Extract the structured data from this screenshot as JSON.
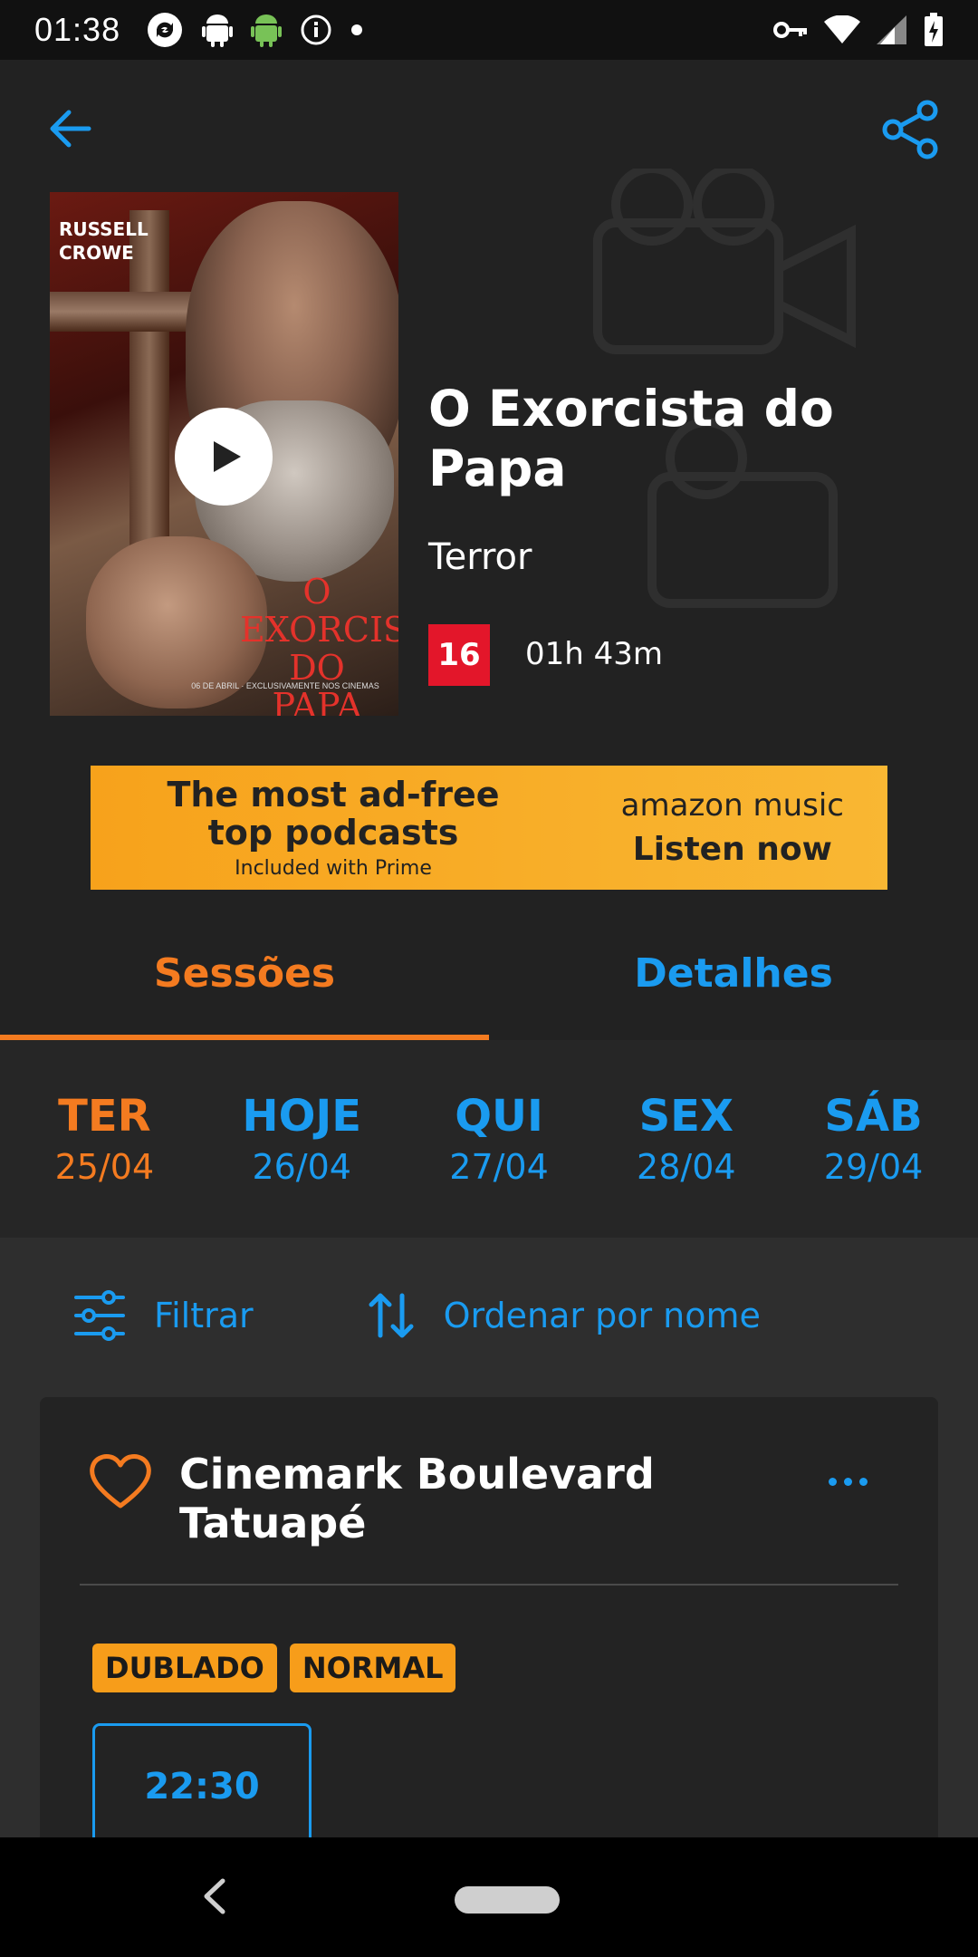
{
  "status_bar": {
    "time": "01:38",
    "left_icons": [
      "sync-icon",
      "android-icon",
      "android-green-icon",
      "info-icon",
      "dot-icon"
    ],
    "right_icons": [
      "vpn-key-icon",
      "wifi-icon",
      "cellular-icon",
      "battery-charging-icon"
    ]
  },
  "header": {
    "back_icon": "arrow-left-icon",
    "share_icon": "share-icon",
    "poster": {
      "actor": "RUSSELL CROWE",
      "title_on_poster": "O EXORCISTA DO PAPA",
      "credits_line": "06 DE ABRIL · EXCLUSIVAMENTE NOS CINEMAS"
    },
    "title": "O Exorcista do Papa",
    "genre": "Terror",
    "rating": "16",
    "duration": "01h 43m"
  },
  "ad": {
    "line1": "The most ad-free",
    "line2": "top podcasts",
    "line3": "Included with Prime",
    "brand": "amazon music",
    "cta": "Listen now",
    "color": "#f9a825"
  },
  "tabs": [
    {
      "label": "Sessões",
      "active": true
    },
    {
      "label": "Detalhes",
      "active": false
    }
  ],
  "dates": [
    {
      "day": "TER",
      "date": "25/04",
      "selected": true
    },
    {
      "day": "HOJE",
      "date": "26/04",
      "selected": false
    },
    {
      "day": "QUI",
      "date": "27/04",
      "selected": false
    },
    {
      "day": "SEX",
      "date": "28/04",
      "selected": false
    },
    {
      "day": "SÁB",
      "date": "29/04",
      "selected": false
    }
  ],
  "toolbar": {
    "filter_label": "Filtrar",
    "sort_label": "Ordenar por nome"
  },
  "cinema": {
    "name": "Cinemark Boulevard Tatuapé",
    "badges": [
      "DUBLADO",
      "NORMAL"
    ],
    "sessions": [
      "22:30"
    ]
  },
  "colors": {
    "accent_orange": "#f47b20",
    "accent_blue": "#1a9bf0",
    "rating_red": "#e3162a",
    "background": "#222222"
  }
}
